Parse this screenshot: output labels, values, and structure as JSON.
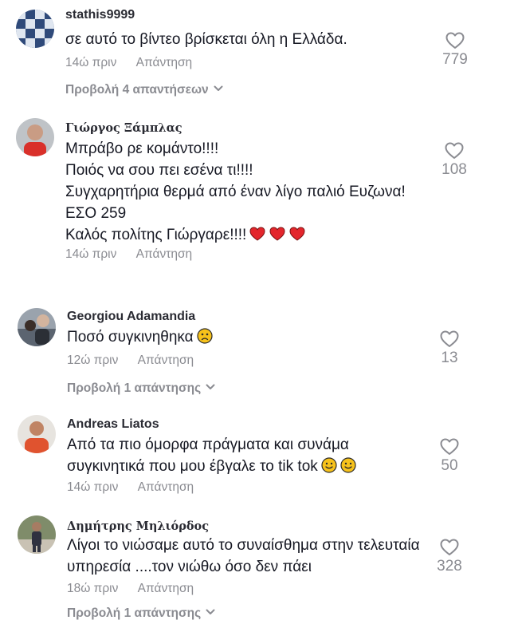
{
  "colors": {
    "text": "#161823",
    "muted": "#8a8b91",
    "heart_red": "#e3262c",
    "emoji_yellow": "#f7c21b"
  },
  "comments": [
    {
      "username": "stathis9999",
      "text": [
        "σε αυτό το βίντεο βρίσκεται όλη η Ελλάδα."
      ],
      "time": "14ώ πριν",
      "reply_label": "Απάντηση",
      "likes": "779",
      "view_replies": "Προβολή 4 απαντήσεων"
    },
    {
      "username": "Γιώργος Ξάμπλας",
      "text": [
        "Μπράβο ρε κομάντο!!!!",
        "Ποιός να σου πει εσένα τι!!!!",
        "Συγχαρητήρια θερμά από έναν λίγο παλιό Ευζωνα!",
        "ΕΣΟ 259",
        "Καλός πολίτης Γιώργαρε!!!!"
      ],
      "time": "14ώ πριν",
      "reply_label": "Απάντηση",
      "likes": "108",
      "emoji": "red-heart-emoji"
    },
    {
      "username": "Georgiou Adamandia",
      "text": [
        "Ποσό συγκινηθηκα"
      ],
      "time": "12ώ πριν",
      "reply_label": "Απάντηση",
      "likes": "13",
      "view_replies": "Προβολή 1 απάντησης",
      "emoji": "worried-face-emoji"
    },
    {
      "username": "Andreas Liatos",
      "text": [
        "Από τα πιο όμορφα πράγματα και συνάμα",
        "συγκινητικά που μου έβγαλε το tik tok"
      ],
      "time": "14ώ πριν",
      "reply_label": "Απάντηση",
      "likes": "50",
      "emoji": "smiling-face-emoji"
    },
    {
      "username": "Δημήτρης Μηλιόρδος",
      "text": [
        "Λίγοι το νιώσαμε αυτό το συναίσθημα στην τελευταία",
        "υπηρεσία ....τον νιώθω όσο δεν πάει"
      ],
      "time": "18ώ πριν",
      "reply_label": "Απάντηση",
      "likes": "328",
      "view_replies": "Προβολή 1 απάντησης"
    }
  ]
}
